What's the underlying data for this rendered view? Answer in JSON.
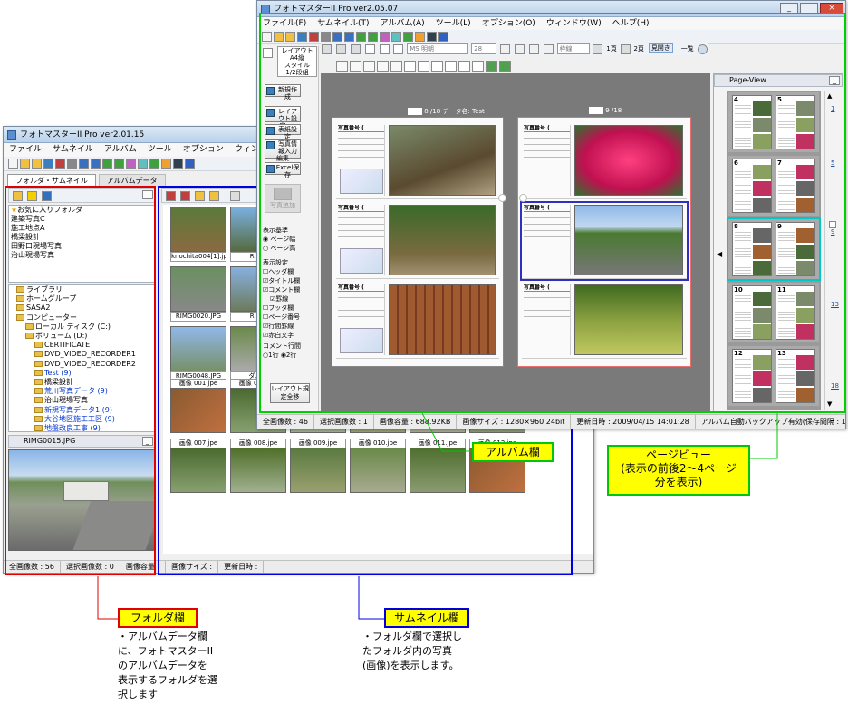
{
  "back_window": {
    "title": "フォトマスターII Pro ver2.01.15",
    "menu": [
      "ファイル",
      "サムネイル",
      "アルバム",
      "ツール",
      "オプション",
      "ウィンドウ",
      "ヘ"
    ],
    "tabs": [
      "フォルダ・サムネイル",
      "アルバムデータ"
    ],
    "favorites": [
      "お気に入りフォルダ",
      "建築写真C",
      "施工地点A",
      "橋梁設計",
      "田野口現場写真",
      "治山現場写真"
    ],
    "tree": [
      {
        "label": "ライブラリ",
        "blue": false
      },
      {
        "label": "ホームグループ",
        "blue": false
      },
      {
        "label": "SASA2",
        "blue": false
      },
      {
        "label": "コンピューター",
        "blue": false
      },
      {
        "label": "ローカル ディスク (C:)",
        "blue": false
      },
      {
        "label": "ボリューム (D:)",
        "blue": false
      },
      {
        "label": "CERTIFICATE",
        "blue": false
      },
      {
        "label": "DVD_VIDEO_RECORDER1",
        "blue": false
      },
      {
        "label": "DVD_VIDEO_RECORDER2",
        "blue": false
      },
      {
        "label": "Test (9)",
        "blue": true
      },
      {
        "label": "橋梁設計",
        "blue": false
      },
      {
        "label": "荒川写真データ (9)",
        "blue": true
      },
      {
        "label": "治山現場写真",
        "blue": false
      },
      {
        "label": "新規写真データ1 (9)",
        "blue": true
      },
      {
        "label": "大谷地区施工工区 (9)",
        "blue": true
      },
      {
        "label": "地盤改良工事 (9)",
        "blue": true
      }
    ],
    "preview_title": "RIMG0015.JPG",
    "thumbs_top": [
      "knochita004[1].jpg",
      "RIMG",
      "RIMG0020.JPG",
      "RIMG",
      "RIMG0048.JPG",
      "ダムち"
    ],
    "thumbs_row1": [
      "画像 001.jpe",
      "画像 002.jpe",
      "画像 003.jpe",
      "画像 004.jpe",
      "画像 005.jpe",
      "画像 006.jpe"
    ],
    "thumbs_row2": [
      "画像 007.jpe",
      "画像 008.jpe",
      "画像 009.jpe",
      "画像 010.jpe",
      "画像 011.jpe",
      "画像 012.jpe"
    ],
    "status": [
      "全画像数 : 56",
      "選択画像数 : 0",
      "画像容量 :",
      "画像サイズ :",
      "更新日時 :"
    ]
  },
  "front_window": {
    "title": "フォトマスターII Pro ver2.05.07",
    "menu": [
      "ファイル(F)",
      "サムネイル(T)",
      "アルバム(A)",
      "ツール(L)",
      "オプション(O)",
      "ウィンドウ(W)",
      "ヘルプ(H)"
    ],
    "layout_label": "レイアウト",
    "layout_value": "A4縦",
    "style_label": "スタイル",
    "style_value": "1/2段組",
    "font_name": "MS 明朝",
    "font_size": "28",
    "frame_label": "枠線",
    "view_1page": "1頁",
    "view_2page": "2頁",
    "view_spread": "見開き",
    "view_list": "一覧",
    "side_buttons": [
      "新規作成",
      "レイアウト設定",
      "表紙設定",
      "写真情報入力編集",
      "Excel保存",
      "写真追加"
    ],
    "display_basis_label": "表示基準",
    "display_basis_options": [
      "ページ幅",
      "ページ高"
    ],
    "display_settings_label": "表示設定",
    "display_checks": [
      "ヘッダ欄",
      "タイトル欄",
      "コメント欄",
      "罫線",
      "フッタ欄",
      "ページ番号",
      "行間罫線",
      "赤白文字"
    ],
    "comment_lines_label": "コメント行間",
    "comment_lines_options": [
      "1行",
      "2行"
    ],
    "layout_batch_button": "レイアウト規定全移",
    "page_left_header": "8 /18 データ名: Test",
    "page_right_header": "9 /18",
    "record_title": "写真番号 (",
    "page_view_title": "Page-View",
    "page_view_numbers": [
      "4",
      "5",
      "6",
      "7",
      "8",
      "9",
      "10",
      "11",
      "12",
      "13"
    ],
    "scroll_ticks": [
      "1",
      "5",
      "9",
      "13",
      "18"
    ],
    "status": [
      "全画像数 : 46",
      "選択画像数 : 1",
      "画像容量 : 688.92KB",
      "画像サイズ : 1280×960 24bit",
      "更新日時 : 2009/04/15 14:01:28",
      "アルバム自動バックアップ有効(保存間隔 : 10分)"
    ]
  },
  "annotations": {
    "album": "アルバム欄",
    "page_view": "ページビュー\n(表示の前後2〜4ページ\n分を表示)",
    "folder": "フォルダ欄",
    "folder_note": [
      "・アルバムデータ欄",
      "に、フォトマスターII",
      "のアルバムデータを",
      "表示するフォルダを選",
      "択します"
    ],
    "thumbnail": "サムネイル欄",
    "thumbnail_note": [
      "・フォルダ欄で選択し",
      "たフォルダ内の写真",
      "(画像)を表示します。"
    ]
  },
  "colors": {
    "folder_box": "#e00000",
    "thumb_box": "#0000e0",
    "album_box": "#00e000",
    "callout_bg": "#ffff00"
  }
}
